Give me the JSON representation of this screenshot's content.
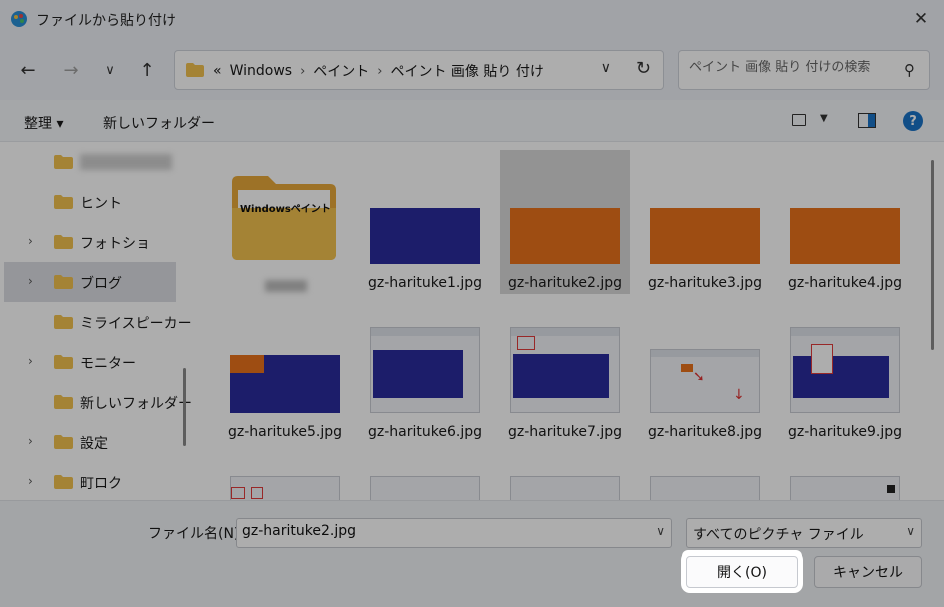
{
  "window": {
    "title": "ファイルから貼り付け",
    "close_icon": "close-icon"
  },
  "nav": {
    "back_icon": "arrow-left-icon",
    "forward_icon": "arrow-right-icon",
    "recent_icon": "chevron-down-icon",
    "up_icon": "arrow-up-icon",
    "breadcrumb": [
      "«",
      "Windows",
      "ペイント",
      "ペイント 画像 貼り 付け"
    ],
    "refresh_icon": "refresh-icon"
  },
  "search": {
    "placeholder": "ペイント 画像 貼り 付けの検索"
  },
  "toolbar": {
    "organize_label": "整理 ▾",
    "new_folder_label": "新しいフォルダー",
    "help_label": "?"
  },
  "sidebar": {
    "items": [
      {
        "label": "",
        "expandable": false,
        "blurred": true
      },
      {
        "label": "ヒント",
        "expandable": false
      },
      {
        "label": "フォトショ",
        "expandable": true
      },
      {
        "label": "ブログ",
        "expandable": true,
        "selected": true
      },
      {
        "label": "ミライスピーカー",
        "expandable": false
      },
      {
        "label": "モニター",
        "expandable": true
      },
      {
        "label": "新しいフォルダー",
        "expandable": false
      },
      {
        "label": "設定",
        "expandable": true
      },
      {
        "label": "町ロク",
        "expandable": true
      }
    ]
  },
  "files": [
    {
      "name": "",
      "kind": "folder",
      "folder_text": "Windowsペイント"
    },
    {
      "name": "gz-harituke1.jpg",
      "kind": "blue"
    },
    {
      "name": "gz-harituke2.jpg",
      "kind": "orange",
      "selected": true
    },
    {
      "name": "gz-harituke3.jpg",
      "kind": "orange"
    },
    {
      "name": "gz-harituke4.jpg",
      "kind": "orange"
    },
    {
      "name": "gz-harituke5.jpg",
      "kind": "blue-corner"
    },
    {
      "name": "gz-harituke6.jpg",
      "kind": "shot-blue"
    },
    {
      "name": "gz-harituke7.jpg",
      "kind": "shot-blue"
    },
    {
      "name": "gz-harituke8.jpg",
      "kind": "shot-white"
    },
    {
      "name": "gz-harituke9.jpg",
      "kind": "shot-blue"
    }
  ],
  "filename": {
    "label": "ファイル名(N):",
    "value": "gz-harituke2.jpg"
  },
  "filetype": {
    "selected": "すべてのピクチャ ファイル"
  },
  "buttons": {
    "open": "開く(O)",
    "cancel": "キャンセル"
  },
  "colors": {
    "accent": "#1a73c8",
    "blue_image": "#2a2c9c",
    "orange_image": "#e9721b",
    "folder": "#f2c14e"
  }
}
